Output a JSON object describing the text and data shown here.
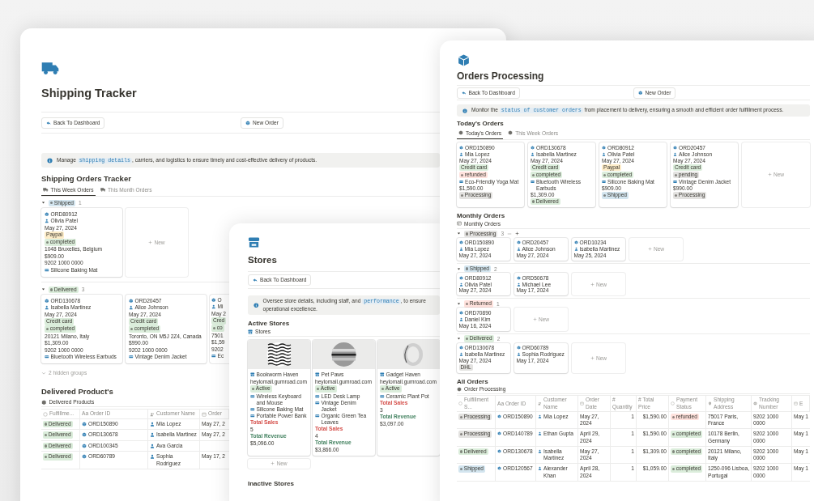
{
  "shipping_window": {
    "title": "Shipping Tracker",
    "buttons": [
      {
        "kind": "back",
        "label": "Back To Dashboard"
      },
      {
        "kind": "new",
        "label": "New Order"
      }
    ],
    "callout": [
      {
        "text": "Manage "
      },
      {
        "text": "shipping details",
        "code": true
      },
      {
        "text": ", carriers, and logistics to ensure timely and cost-effective delivery of products."
      }
    ],
    "board": {
      "heading": "Shipping Orders Tracker",
      "tabs": [
        {
          "label": "This Week Orders",
          "selected": true
        },
        {
          "label": "This Month Orders",
          "selected": false
        }
      ],
      "groups": [
        {
          "tag": {
            "text": "Shipped",
            "color": "#d3e5ef"
          },
          "count": "1",
          "expanded": true,
          "hovered": false,
          "new_label": "New",
          "cards": [
            {
              "lines": [
                {
                  "kind": "order",
                  "text": "ORD80912"
                },
                {
                  "kind": "person",
                  "text": "Olivia Patel"
                },
                {
                  "kind": "text",
                  "text": "May 27, 2024"
                },
                {
                  "kind": "tag",
                  "text": "Paypal",
                  "color": "#fdecc8"
                },
                {
                  "kind": "status",
                  "text": "completed",
                  "color": "#dbeddb"
                },
                {
                  "kind": "text",
                  "text": "1048 Bruxelles, Belgium"
                },
                {
                  "kind": "text",
                  "text": "$909.00"
                },
                {
                  "kind": "text",
                  "text": "9202 1000 0000"
                },
                {
                  "kind": "product",
                  "text": "Silicone Baking Mat"
                }
              ]
            }
          ]
        },
        {
          "tag": {
            "text": "Delivered",
            "color": "#dbeddb"
          },
          "count": "3",
          "expanded": true,
          "hovered": false,
          "cards": [
            {
              "lines": [
                {
                  "kind": "order",
                  "text": "ORD130678"
                },
                {
                  "kind": "person",
                  "text": "Isabella Martinez"
                },
                {
                  "kind": "text",
                  "text": "May 27, 2024"
                },
                {
                  "kind": "tag",
                  "text": "Credit card",
                  "color": "#dbeddb"
                },
                {
                  "kind": "status",
                  "text": "completed",
                  "color": "#dbeddb"
                },
                {
                  "kind": "text",
                  "text": "20121 Milano, Italy"
                },
                {
                  "kind": "text",
                  "text": "$1,309.00"
                },
                {
                  "kind": "text",
                  "text": "9202 1000 0000"
                },
                {
                  "kind": "product",
                  "text": "Bluetooth Wireless Earbuds"
                }
              ]
            },
            {
              "lines": [
                {
                  "kind": "order",
                  "text": "ORD20457"
                },
                {
                  "kind": "person",
                  "text": "Alice Johnson"
                },
                {
                  "kind": "text",
                  "text": "May 27, 2024"
                },
                {
                  "kind": "tag",
                  "text": "Credit card",
                  "color": "#dbeddb"
                },
                {
                  "kind": "status",
                  "text": "completed",
                  "color": "#dbeddb"
                },
                {
                  "kind": "text",
                  "text": "Toronto, ON M5J 2Z4, Canada"
                },
                {
                  "kind": "text",
                  "text": "$990.00"
                },
                {
                  "kind": "text",
                  "text": "9202 1000 0000"
                },
                {
                  "kind": "product",
                  "text": "Vintage Denim Jacket"
                }
              ]
            },
            {
              "lines": [
                {
                  "kind": "order",
                  "text": "O"
                },
                {
                  "kind": "person",
                  "text": "Mi"
                },
                {
                  "kind": "text",
                  "text": "May 2"
                },
                {
                  "kind": "tag",
                  "text": "Cred",
                  "color": "#dbeddb"
                },
                {
                  "kind": "status",
                  "text": "co",
                  "color": "#dbeddb"
                },
                {
                  "kind": "text",
                  "text": "7501"
                },
                {
                  "kind": "text",
                  "text": "$1,59"
                },
                {
                  "kind": "text",
                  "text": "9202"
                },
                {
                  "kind": "product",
                  "text": "Ec"
                }
              ]
            }
          ]
        }
      ],
      "hidden_groups": "2 hidden groups"
    },
    "table": {
      "heading": "Delivered Product's",
      "view": "Delivered Products",
      "columns": [
        {
          "kind": "status",
          "label": "Fulfillme..."
        },
        {
          "kind": "title",
          "label": "Aa Order ID"
        },
        {
          "kind": "person",
          "label": "Customer Name"
        },
        {
          "kind": "date",
          "label": "Order"
        }
      ],
      "rows": [
        {
          "cells": [
            {
              "kind": "status",
              "text": "Delivered",
              "color": "#dbeddb"
            },
            {
              "kind": "order",
              "text": "ORD150890"
            },
            {
              "kind": "person",
              "text": "Mia Lopez"
            },
            {
              "kind": "text",
              "text": "May 27, 2"
            }
          ]
        },
        {
          "cells": [
            {
              "kind": "status",
              "text": "Delivered",
              "color": "#dbeddb"
            },
            {
              "kind": "order",
              "text": "ORD130678"
            },
            {
              "kind": "person",
              "text": "Isabella Martinez"
            },
            {
              "kind": "text",
              "text": "May 27, 2"
            }
          ]
        },
        {
          "cells": [
            {
              "kind": "status",
              "text": "Delivered",
              "color": "#dbeddb"
            },
            {
              "kind": "order",
              "text": "ORD100345"
            },
            {
              "kind": "person",
              "text": "Ava Garcia"
            },
            {
              "kind": "empty"
            }
          ]
        },
        {
          "cells": [
            {
              "kind": "status",
              "text": "Delivered",
              "color": "#dbeddb"
            },
            {
              "kind": "order",
              "text": "ORD60789"
            },
            {
              "kind": "person",
              "text": "Sophia Rodriguez"
            },
            {
              "kind": "text",
              "text": "May 17, 2"
            }
          ]
        }
      ]
    }
  },
  "stores_window": {
    "title": "Stores",
    "buttons": [
      {
        "kind": "back",
        "label": "Back To Dashboard"
      }
    ],
    "callout": [
      {
        "text": "Oversee store details, including staff, and "
      },
      {
        "text": "performance",
        "code": true
      },
      {
        "text": ", to ensure operational excellence."
      }
    ],
    "heading": "Active Stores",
    "view": "Stores",
    "cards": [
      {
        "image": {
          "kind": "picture"
        },
        "lines": [
          {
            "kind": "store",
            "text": "Bookworm Haven"
          },
          {
            "kind": "text",
            "text": "heylomail.gumroad.com"
          },
          {
            "kind": "status",
            "text": "Active",
            "color": "#dbeddb"
          },
          {
            "kind": "products",
            "items": [
              "Wireless Keyboard and Mouse",
              "Silicone Baking Mat",
              "Portable Power Bank"
            ]
          },
          {
            "kind": "label",
            "text": "Total Sales",
            "color": "#d44c47"
          },
          {
            "kind": "text",
            "text": "5"
          },
          {
            "kind": "label",
            "text": "Total Revenue",
            "color": "#448361"
          },
          {
            "kind": "text",
            "text": "$5,096.00"
          }
        ]
      },
      {
        "image": {
          "kind": "picture"
        },
        "lines": [
          {
            "kind": "store",
            "text": "Pet Paws"
          },
          {
            "kind": "text",
            "text": "heylomail.gumroad.com"
          },
          {
            "kind": "status",
            "text": "Active",
            "color": "#dbeddb"
          },
          {
            "kind": "products",
            "items": [
              "LED Desk Lamp",
              "Vintage Denim Jacket",
              "Organic Green Tea Leaves"
            ]
          },
          {
            "kind": "label",
            "text": "Total Sales",
            "color": "#d44c47"
          },
          {
            "kind": "text",
            "text": "4"
          },
          {
            "kind": "label",
            "text": "Total Revenue",
            "color": "#448361"
          },
          {
            "kind": "text",
            "text": "$3,866.00"
          }
        ]
      },
      {
        "image": {
          "kind": "picture"
        },
        "lines": [
          {
            "kind": "store",
            "text": "Gadget Haven"
          },
          {
            "kind": "text",
            "text": "heylomail.gumroad.com"
          },
          {
            "kind": "status",
            "text": "Active",
            "color": "#dbeddb"
          },
          {
            "kind": "products",
            "items": [
              "Ceramic Plant Pot"
            ]
          },
          {
            "kind": "label",
            "text": "Total Sales",
            "color": "#d44c47"
          },
          {
            "kind": "text",
            "text": "3"
          },
          {
            "kind": "label",
            "text": "Total Revenue",
            "color": "#448361"
          },
          {
            "kind": "text",
            "text": "$3,097.00"
          }
        ]
      }
    ],
    "new_label": "New",
    "inactive_heading": "Inactive Stores"
  },
  "orders_window": {
    "title": "Orders Processing",
    "buttons": [
      {
        "kind": "back",
        "label": "Back To Dashboard"
      },
      {
        "kind": "new",
        "label": "New Order"
      }
    ],
    "callout": [
      {
        "text": "Monitor the "
      },
      {
        "text": "status of customer orders",
        "code": true
      },
      {
        "text": " from placement to delivery, ensuring a smooth and efficient order fulfillment process."
      }
    ],
    "today": {
      "heading": "Today's Orders",
      "tabs": [
        {
          "label": "Today's Orders",
          "selected": true
        },
        {
          "label": "This Week Orders",
          "selected": false
        }
      ],
      "new_label": "New",
      "cards": [
        {
          "lines": [
            {
              "kind": "order",
              "text": "ORD150890"
            },
            {
              "kind": "person",
              "text": "Mia Lopez"
            },
            {
              "kind": "text",
              "text": "May 27, 2024"
            },
            {
              "kind": "tag",
              "text": "Credit card",
              "color": "#dbeddb"
            },
            {
              "kind": "status",
              "text": "refunded",
              "color": "#ffe2dd"
            },
            {
              "kind": "product",
              "text": "Eco-Friendly Yoga Mat"
            },
            {
              "kind": "text",
              "text": "$1,590.00"
            },
            {
              "kind": "status",
              "text": "Processing",
              "color": "#e3e2e0"
            }
          ]
        },
        {
          "lines": [
            {
              "kind": "order",
              "text": "ORD130678"
            },
            {
              "kind": "person",
              "text": "Isabella Martinez"
            },
            {
              "kind": "text",
              "text": "May 27, 2024"
            },
            {
              "kind": "tag",
              "text": "Credit card",
              "color": "#dbeddb"
            },
            {
              "kind": "status",
              "text": "completed",
              "color": "#dbeddb"
            },
            {
              "kind": "product",
              "text": "Bluetooth Wireless Earbuds"
            },
            {
              "kind": "text",
              "text": "$1,309.00"
            },
            {
              "kind": "status",
              "text": "Delivered",
              "color": "#dbeddb"
            }
          ]
        },
        {
          "lines": [
            {
              "kind": "order",
              "text": "ORD80912"
            },
            {
              "kind": "person",
              "text": "Olivia Patel"
            },
            {
              "kind": "text",
              "text": "May 27, 2024"
            },
            {
              "kind": "tag",
              "text": "Paypal",
              "color": "#fdecc8"
            },
            {
              "kind": "status",
              "text": "completed",
              "color": "#dbeddb"
            },
            {
              "kind": "product",
              "text": "Silicone Baking Mat"
            },
            {
              "kind": "text",
              "text": "$909.00"
            },
            {
              "kind": "status",
              "text": "Shipped",
              "color": "#d3e5ef"
            }
          ]
        },
        {
          "lines": [
            {
              "kind": "order",
              "text": "ORD20457"
            },
            {
              "kind": "person",
              "text": "Alice Johnson"
            },
            {
              "kind": "text",
              "text": "May 27, 2024"
            },
            {
              "kind": "tag",
              "text": "Credit card",
              "color": "#dbeddb"
            },
            {
              "kind": "status",
              "text": "pending",
              "color": "#e3e2e0"
            },
            {
              "kind": "product",
              "text": "Vintage Denim Jacket"
            },
            {
              "kind": "text",
              "text": "$990.00"
            },
            {
              "kind": "status",
              "text": "Processing",
              "color": "#e3e2e0"
            }
          ]
        }
      ]
    },
    "monthly": {
      "heading": "Monthly Orders",
      "view": "Monthly Orders",
      "groups": [
        {
          "tag": {
            "text": "Processing",
            "color": "#e3e2e0"
          },
          "count": "3",
          "expanded": true,
          "hovered": true,
          "new_label": "New",
          "cards": [
            {
              "lines": [
                {
                  "kind": "order",
                  "text": "ORD150890"
                },
                {
                  "kind": "person",
                  "text": "Mia Lopez"
                },
                {
                  "kind": "text",
                  "text": "May 27, 2024"
                }
              ]
            },
            {
              "lines": [
                {
                  "kind": "order",
                  "text": "ORD20457"
                },
                {
                  "kind": "person",
                  "text": "Alice Johnson"
                },
                {
                  "kind": "text",
                  "text": "May 27, 2024"
                }
              ]
            },
            {
              "lines": [
                {
                  "kind": "order",
                  "text": "ORD10234"
                },
                {
                  "kind": "person",
                  "text": "Isabella Martinez"
                },
                {
                  "kind": "text",
                  "text": "May 25, 2024"
                }
              ]
            }
          ]
        },
        {
          "tag": {
            "text": "Shipped",
            "color": "#d3e5ef"
          },
          "count": "2",
          "expanded": true,
          "hovered": false,
          "new_label": "New",
          "cards": [
            {
              "lines": [
                {
                  "kind": "order",
                  "text": "ORD80912"
                },
                {
                  "kind": "person",
                  "text": "Olivia Patel"
                },
                {
                  "kind": "text",
                  "text": "May 27, 2024"
                }
              ]
            },
            {
              "lines": [
                {
                  "kind": "order",
                  "text": "ORD50678"
                },
                {
                  "kind": "person",
                  "text": "Michael Lee"
                },
                {
                  "kind": "text",
                  "text": "May 17, 2024"
                }
              ]
            }
          ]
        },
        {
          "tag": {
            "text": "Returned",
            "color": "#ffe2dd"
          },
          "count": "1",
          "expanded": true,
          "hovered": false,
          "new_label": "New",
          "cards": [
            {
              "lines": [
                {
                  "kind": "order",
                  "text": "ORD70890"
                },
                {
                  "kind": "person",
                  "text": "Daniel Kim"
                },
                {
                  "kind": "text",
                  "text": "May 16, 2024"
                }
              ]
            }
          ]
        },
        {
          "tag": {
            "text": "Delivered",
            "color": "#dbeddb"
          },
          "count": "2",
          "expanded": true,
          "hovered": false,
          "new_label": "New",
          "cards": [
            {
              "lines": [
                {
                  "kind": "order",
                  "text": "ORD130678"
                },
                {
                  "kind": "person",
                  "text": "Isabella Martinez"
                },
                {
                  "kind": "text",
                  "text": "May 27, 2024"
                },
                {
                  "kind": "tag",
                  "text": "DHL",
                  "color": "#e3e2e0"
                }
              ]
            },
            {
              "lines": [
                {
                  "kind": "order",
                  "text": "ORD60789"
                },
                {
                  "kind": "person",
                  "text": "Sophia Rodriguez"
                },
                {
                  "kind": "text",
                  "text": "May 17, 2024"
                }
              ]
            }
          ]
        }
      ]
    },
    "table": {
      "heading": "All Orders",
      "view": "Order Processing",
      "columns": [
        {
          "kind": "status",
          "label": "Fulfillment S..."
        },
        {
          "kind": "title",
          "label": "Aa Order ID"
        },
        {
          "kind": "person",
          "label": "Customer Name"
        },
        {
          "kind": "date",
          "label": "Order Date"
        },
        {
          "kind": "title",
          "label": "# Quantity"
        },
        {
          "kind": "title",
          "label": "# Total Price"
        },
        {
          "kind": "status",
          "label": "Payment Status"
        },
        {
          "kind": "pin",
          "label": "Shipping Address"
        },
        {
          "kind": "globe",
          "label": "Tracking Number"
        },
        {
          "kind": "date",
          "label": "E"
        }
      ],
      "rows": [
        {
          "cells": [
            {
              "kind": "status",
              "text": "Processing",
              "color": "#e3e2e0"
            },
            {
              "kind": "order",
              "text": "ORD150890"
            },
            {
              "kind": "person",
              "text": "Mia Lopez"
            },
            {
              "kind": "text",
              "text": "May 27, 2024"
            },
            {
              "kind": "number",
              "text": "1"
            },
            {
              "kind": "number",
              "text": "$1,590.00"
            },
            {
              "kind": "status",
              "text": "refunded",
              "color": "#ffe2dd"
            },
            {
              "kind": "text",
              "text": "75017 Paris, France"
            },
            {
              "kind": "text",
              "text": "9202 1000 0000"
            },
            {
              "kind": "text",
              "text": "May 1"
            }
          ]
        },
        {
          "cells": [
            {
              "kind": "status",
              "text": "Processing",
              "color": "#e3e2e0"
            },
            {
              "kind": "order",
              "text": "ORD140789"
            },
            {
              "kind": "person",
              "text": "Ethan Gupta"
            },
            {
              "kind": "text",
              "text": "April 29, 2024"
            },
            {
              "kind": "number",
              "text": "1"
            },
            {
              "kind": "number",
              "text": "$1,590.00"
            },
            {
              "kind": "status",
              "text": "completed",
              "color": "#dbeddb"
            },
            {
              "kind": "text",
              "text": "10178 Berlin, Germany"
            },
            {
              "kind": "text",
              "text": "9202 1000 0000"
            },
            {
              "kind": "text",
              "text": "May 1"
            }
          ]
        },
        {
          "cells": [
            {
              "kind": "status",
              "text": "Delivered",
              "color": "#dbeddb"
            },
            {
              "kind": "order",
              "text": "ORD130678"
            },
            {
              "kind": "person",
              "text": "Isabella Martinez"
            },
            {
              "kind": "text",
              "text": "May 27, 2024"
            },
            {
              "kind": "number",
              "text": "1"
            },
            {
              "kind": "number",
              "text": "$1,309.00"
            },
            {
              "kind": "status",
              "text": "completed",
              "color": "#dbeddb"
            },
            {
              "kind": "text",
              "text": "20121 Milano, Italy"
            },
            {
              "kind": "text",
              "text": "9202 1000 0000"
            },
            {
              "kind": "text",
              "text": "May 1"
            }
          ]
        },
        {
          "cells": [
            {
              "kind": "status",
              "text": "Shipped",
              "color": "#d3e5ef"
            },
            {
              "kind": "order",
              "text": "ORD120567"
            },
            {
              "kind": "person",
              "text": "Alexander Khan"
            },
            {
              "kind": "text",
              "text": "April 28, 2024"
            },
            {
              "kind": "number",
              "text": "1"
            },
            {
              "kind": "number",
              "text": "$1,059.00"
            },
            {
              "kind": "status",
              "text": "completed",
              "color": "#dbeddb"
            },
            {
              "kind": "text",
              "text": "1250-096 Lisboa, Portugal"
            },
            {
              "kind": "text",
              "text": "9202 1000 0000"
            },
            {
              "kind": "text",
              "text": "May 1"
            }
          ]
        }
      ]
    }
  }
}
